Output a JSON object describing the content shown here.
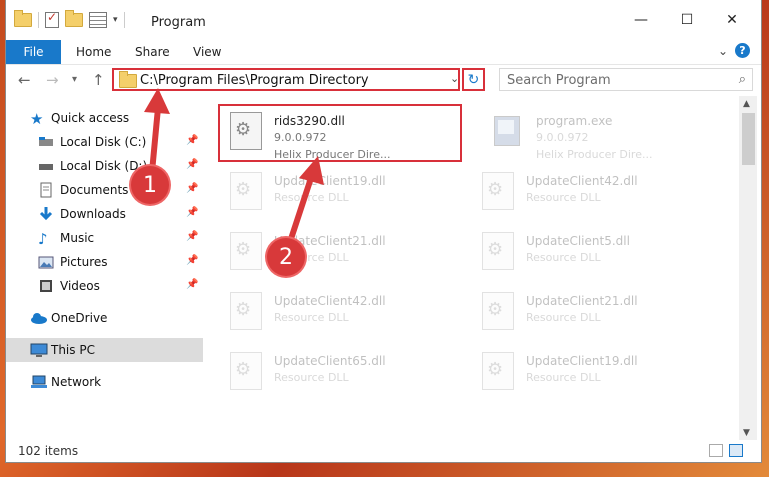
{
  "window": {
    "title": "Program",
    "controls": {
      "minimize": "—",
      "maximize": "☐",
      "close": "✕"
    }
  },
  "ribbon": {
    "tabs": [
      {
        "label": "File",
        "active": true
      },
      {
        "label": "Home"
      },
      {
        "label": "Share"
      },
      {
        "label": "View"
      }
    ],
    "help": "?"
  },
  "nav_buttons": {
    "back": "←",
    "forward": "→",
    "recent": "▾",
    "up": "↑"
  },
  "address": {
    "path": "C:\\Program Files\\Program Directory",
    "refresh": "↻"
  },
  "search": {
    "placeholder": "Search Program",
    "icon": "⌕"
  },
  "sidebar": {
    "items": [
      {
        "label": "Quick access",
        "icon": "star-icon"
      },
      {
        "label": "Local Disk (C:)",
        "icon": "drive-icon",
        "pinned": true
      },
      {
        "label": "Local Disk (D:)",
        "icon": "drive-icon",
        "pinned": true
      },
      {
        "label": "Documents",
        "icon": "documents-icon",
        "pinned": true
      },
      {
        "label": "Downloads",
        "icon": "downloads-icon",
        "pinned": true
      },
      {
        "label": "Music",
        "icon": "music-icon",
        "pinned": true
      },
      {
        "label": "Pictures",
        "icon": "pictures-icon",
        "pinned": true
      },
      {
        "label": "Videos",
        "icon": "videos-icon",
        "pinned": true
      },
      {
        "label": "OneDrive",
        "icon": "cloud-icon"
      },
      {
        "label": "This PC",
        "icon": "computer-icon",
        "selected": true
      },
      {
        "label": "Network",
        "icon": "network-icon"
      }
    ]
  },
  "files": [
    {
      "name": "rids3290.dll",
      "line2": "9.0.0.972",
      "line3": "Helix Producer Dire...",
      "type": "dll",
      "highlighted": true
    },
    {
      "name": "program.exe",
      "line2": "9.0.0.972",
      "line3": "Helix Producer Dire...",
      "type": "exe"
    },
    {
      "name": "UpdateClient19.dll",
      "line2": "Resource DLL",
      "type": "dll"
    },
    {
      "name": "UpdateClient42.dll",
      "line2": "Resource DLL",
      "type": "dll"
    },
    {
      "name": "UpdateClient21.dll",
      "line2": "Resource DLL",
      "type": "dll"
    },
    {
      "name": "UpdateClient5.dll",
      "line2": "Resource DLL",
      "type": "dll"
    },
    {
      "name": "UpdateClient42.dll",
      "line2": "Resource DLL",
      "type": "dll"
    },
    {
      "name": "UpdateClient21.dll",
      "line2": "Resource DLL",
      "type": "dll"
    },
    {
      "name": "UpdateClient65.dll",
      "line2": "Resource DLL",
      "type": "dll"
    },
    {
      "name": "UpdateClient19.dll",
      "line2": "Resource DLL",
      "type": "dll"
    }
  ],
  "status": {
    "item_count": "102 items"
  },
  "annotations": [
    {
      "number": "1"
    },
    {
      "number": "2"
    }
  ],
  "colors": {
    "accent": "#1979ca",
    "highlight": "#d8303a"
  }
}
